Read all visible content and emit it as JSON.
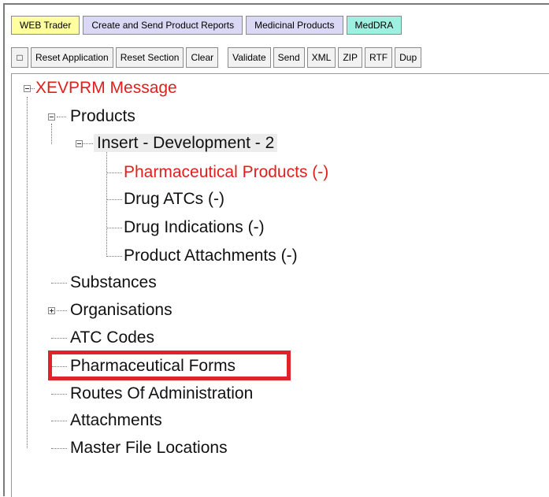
{
  "tabs": [
    "WEB Trader",
    "Create and Send Product Reports",
    "Medicinal Products",
    "MedDRA"
  ],
  "toolbar": {
    "square": "□",
    "reset_application": "Reset Application",
    "reset_section": "Reset Section",
    "clear": "Clear",
    "validate": "Validate",
    "send": "Send",
    "xml": "XML",
    "zip": "ZIP",
    "rtf": "RTF",
    "dup": "Dup"
  },
  "tree": {
    "root": "XEVPRM Message",
    "products": "Products",
    "insert": "Insert - Development - 2",
    "pharm_products": "Pharmaceutical Products (-)",
    "drug_atcs": "Drug ATCs (-)",
    "drug_indications": "Drug Indications (-)",
    "product_attachments": "Product Attachments (-)",
    "substances": "Substances",
    "organisations": "Organisations",
    "atc_codes": "ATC Codes",
    "pharm_forms": "Pharmaceutical Forms",
    "routes": "Routes Of Administration",
    "attachments": "Attachments",
    "master_file": "Master File Locations"
  },
  "colors": {
    "accent_red": "#e0201c",
    "highlight_box": "#e0222a"
  }
}
